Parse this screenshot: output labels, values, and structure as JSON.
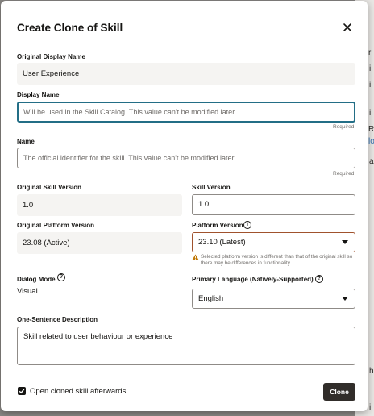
{
  "background": {
    "fragments": [
      "ri",
      "i",
      "i",
      "i",
      "Re",
      "lo",
      "a",
      "h",
      "i"
    ]
  },
  "dialog": {
    "title": "Create Clone of Skill",
    "close_icon": "close-icon",
    "original_display_name": {
      "label": "Original Display Name",
      "value": "User Experience"
    },
    "display_name": {
      "label": "Display Name",
      "placeholder": "Will be used in the Skill Catalog. This value can't be modified later.",
      "required": "Required"
    },
    "name": {
      "label": "Name",
      "placeholder": "The official identifier for the skill. This value can't be modified later.",
      "required": "Required"
    },
    "original_skill_version": {
      "label": "Original Skill Version",
      "value": "1.0"
    },
    "skill_version": {
      "label": "Skill Version",
      "value": "1.0"
    },
    "original_platform_version": {
      "label": "Original Platform Version",
      "value": "23.08 (Active)"
    },
    "platform_version": {
      "label": "Platform Version",
      "value": "23.10 (Latest)",
      "warning": "Selected platform version is different than that of the original skill so there may be differences in functionality."
    },
    "dialog_mode": {
      "label": "Dialog Mode",
      "value": "Visual"
    },
    "primary_language": {
      "label": "Primary Language (Natively-Supported)",
      "value": "English"
    },
    "description": {
      "label": "One-Sentence Description",
      "value": "Skill related to user behaviour or experience"
    },
    "open_after": {
      "label": "Open cloned skill afterwards",
      "checked": true
    },
    "clone_button": "Clone"
  },
  "colors": {
    "focus": "#236e86",
    "primary_button": "#312d2a",
    "warning": "#c17a0a"
  }
}
